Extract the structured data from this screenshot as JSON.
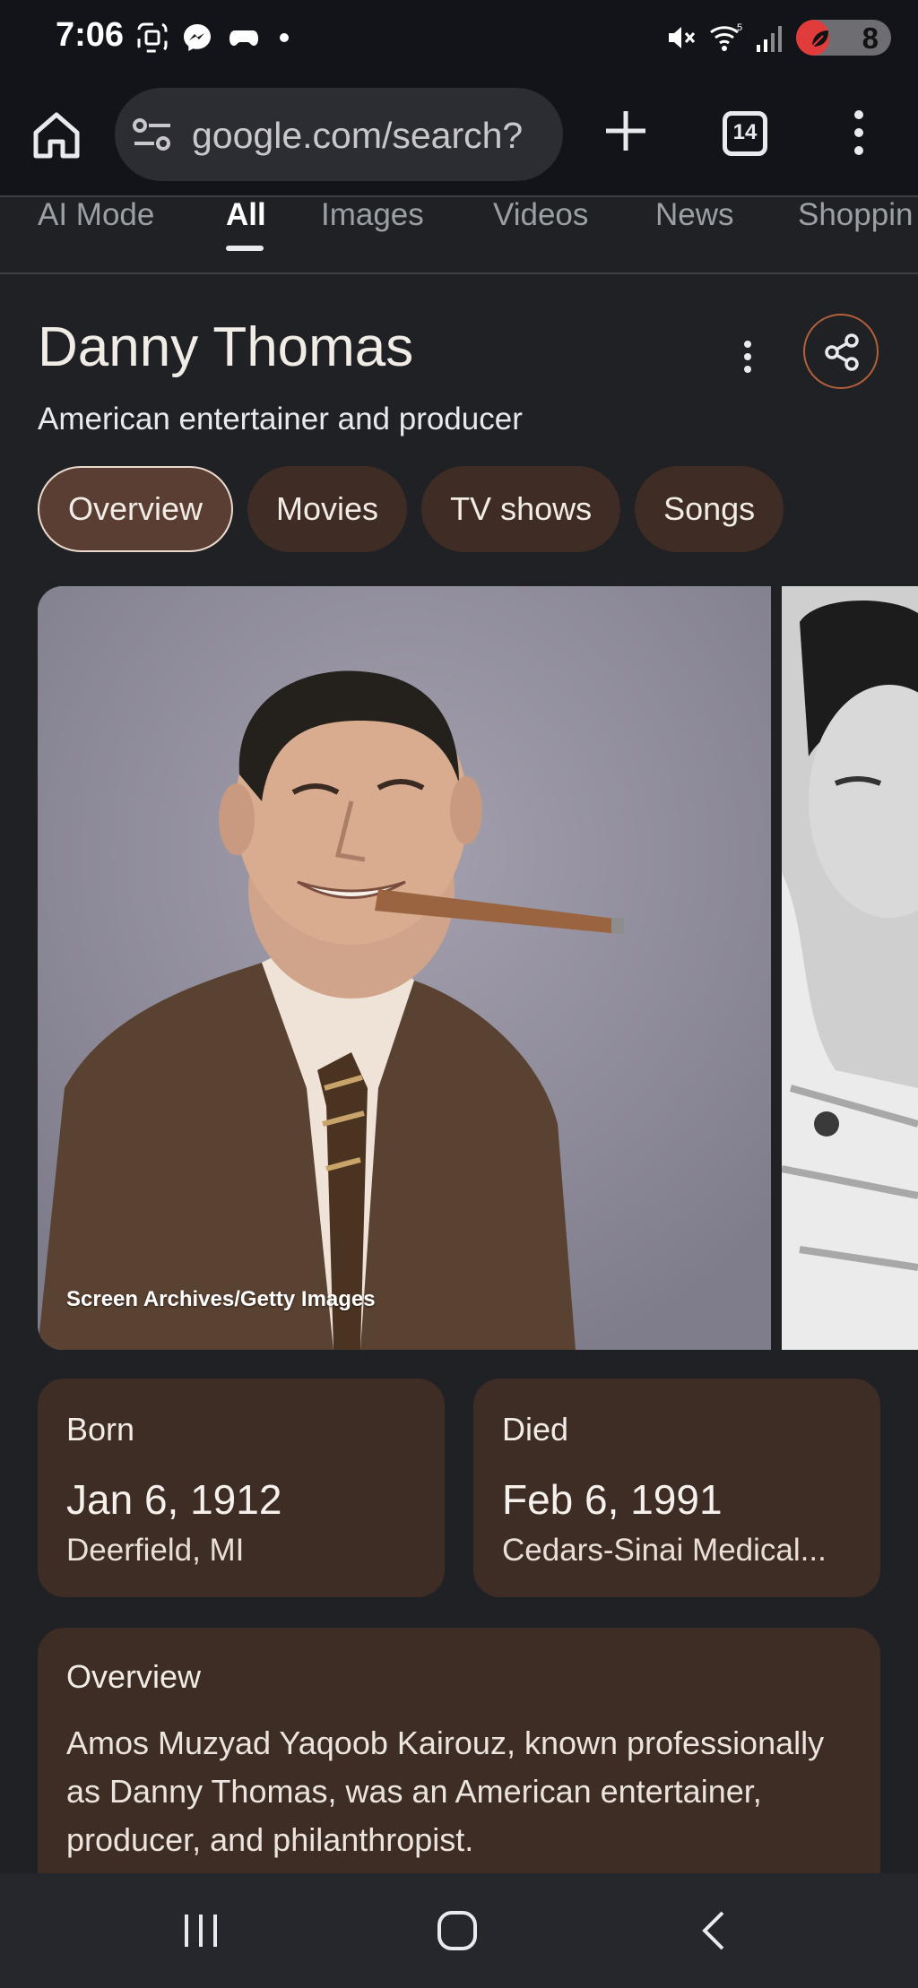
{
  "status_bar": {
    "time": "7:06",
    "battery_level": "8",
    "battery_fraction": 0.08,
    "icons_left": [
      "screenshot-icon",
      "messenger-icon",
      "gaming-icon",
      "notification-dot-icon"
    ],
    "icons_right": [
      "mute-icon",
      "wifi-icon",
      "signal-icon",
      "battery-icon"
    ]
  },
  "browser": {
    "url": "google.com/search?",
    "tab_count": "14"
  },
  "search_tabs": [
    "AI Mode",
    "All",
    "Images",
    "Videos",
    "News",
    "Shoppin"
  ],
  "knowledge_panel": {
    "title": "Danny Thomas",
    "subtitle": "American entertainer and producer",
    "chips": [
      "Overview",
      "Movies",
      "TV shows",
      "Songs"
    ],
    "image_credit": "Screen Archives/Getty Images",
    "born": {
      "label": "Born",
      "date": "Jan 6, 1912",
      "place": "Deerfield, MI"
    },
    "died": {
      "label": "Died",
      "date": "Feb 6, 1991",
      "place": "Cedars-Sinai Medical..."
    },
    "overview": {
      "title": "Overview",
      "text": "Amos Muzyad Yaqoob Kairouz, known professionally as Danny Thomas, was an American entertainer, producer, and philanthropist."
    }
  },
  "colors": {
    "background": "#202124",
    "chip": "#3f2c24",
    "card": "#3d2d25",
    "accent_share": "#b25f3b"
  }
}
